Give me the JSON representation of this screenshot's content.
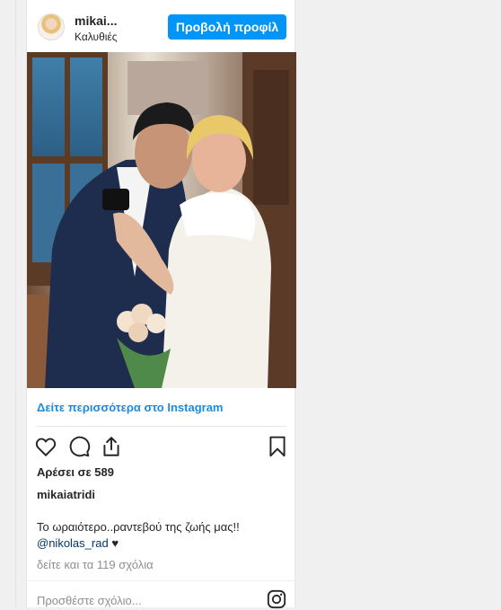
{
  "post": {
    "username": "mikai...",
    "location": "Καλυθιές",
    "profile_button": "Προβολή προφίλ",
    "view_more": "Δείτε περισσότερα στο Instagram",
    "likes": "Αρέσει σε 589",
    "author": "mikaiatridi",
    "caption_text": "Το ωραιότερο..ραντεβού της ζωής μας!!",
    "caption_mention": "@nikolas_rad",
    "caption_heart": "♥",
    "view_comments": "δείτε και τα 119 σχόλια",
    "comment_placeholder": "Προσθέστε σχόλιο..."
  },
  "colors": {
    "accent": "#0095f6",
    "link": "#1f8ad6",
    "muted": "#8e8e8e"
  },
  "icons": [
    "heart-icon",
    "comment-icon",
    "share-icon",
    "bookmark-icon",
    "instagram-icon"
  ]
}
